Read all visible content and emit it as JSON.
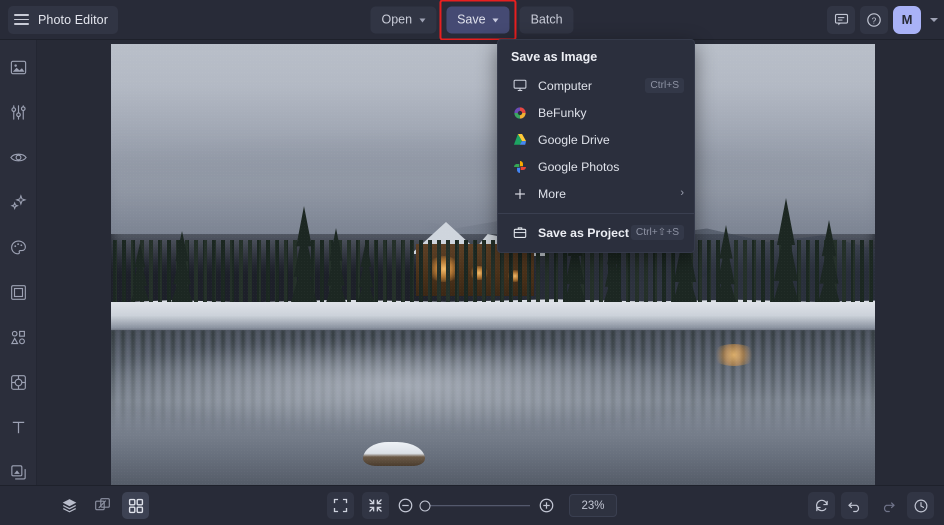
{
  "app": {
    "title": "Photo Editor",
    "menu_icon": "hamburger-icon"
  },
  "toolbar": {
    "open_label": "Open",
    "save_label": "Save",
    "batch_label": "Batch",
    "feedback_icon": "feedback-icon",
    "help_icon": "help-circle-icon",
    "avatar_initial": "M"
  },
  "highlight_color": "#e81f1f",
  "avatar_color": "#a9b2f7",
  "save_menu": {
    "header": "Save as Image",
    "items": [
      {
        "label": "Computer",
        "icon": "monitor-icon",
        "shortcut": "Ctrl+S"
      },
      {
        "label": "BeFunky",
        "icon": "befunky-logo-icon",
        "shortcut": ""
      },
      {
        "label": "Google Drive",
        "icon": "google-drive-icon",
        "shortcut": ""
      },
      {
        "label": "Google Photos",
        "icon": "google-photos-icon",
        "shortcut": ""
      },
      {
        "label": "More",
        "icon": "plus-icon",
        "shortcut": "",
        "arrow": "›"
      }
    ],
    "project": {
      "label": "Save as Project",
      "icon": "briefcase-icon",
      "shortcut": "Ctrl+⇧+S"
    }
  },
  "sidebar": {
    "items": [
      {
        "name": "sidebar-item-edit",
        "icon": "image-icon"
      },
      {
        "name": "sidebar-item-adjust",
        "icon": "sliders-icon"
      },
      {
        "name": "sidebar-item-touchup",
        "icon": "eye-icon"
      },
      {
        "name": "sidebar-item-effects",
        "icon": "sparkles-icon"
      },
      {
        "name": "sidebar-item-artsy",
        "icon": "palette-icon"
      },
      {
        "name": "sidebar-item-frames",
        "icon": "frame-icon"
      },
      {
        "name": "sidebar-item-graphics",
        "icon": "shapes-icon"
      },
      {
        "name": "sidebar-item-overlays",
        "icon": "overlay-icon"
      },
      {
        "name": "sidebar-item-text",
        "icon": "text-icon"
      },
      {
        "name": "sidebar-item-textures",
        "icon": "layers-stack-icon"
      }
    ]
  },
  "canvas": {
    "image_description": "Snowy mountain lake with wooden lodge and reflections"
  },
  "bottombar": {
    "left_tools": [
      {
        "name": "layers-button",
        "icon": "layers-icon",
        "selected": false
      },
      {
        "name": "compare-button",
        "icon": "compare-icon",
        "selected": false
      },
      {
        "name": "grid-button",
        "icon": "grid-icon",
        "selected": true
      }
    ],
    "fit_icon": "fit-screen-icon",
    "fullscreen_icon": "collapse-icon",
    "zoom_out_icon": "minus-circle-icon",
    "zoom_in_icon": "plus-circle-icon",
    "zoom_value": "23%",
    "right_tools": [
      {
        "name": "reset-button",
        "icon": "reset-icon",
        "disabled": false
      },
      {
        "name": "undo-button",
        "icon": "undo-icon",
        "disabled": false
      },
      {
        "name": "redo-button",
        "icon": "redo-icon",
        "disabled": true
      },
      {
        "name": "history-button",
        "icon": "history-icon",
        "disabled": false
      }
    ]
  }
}
